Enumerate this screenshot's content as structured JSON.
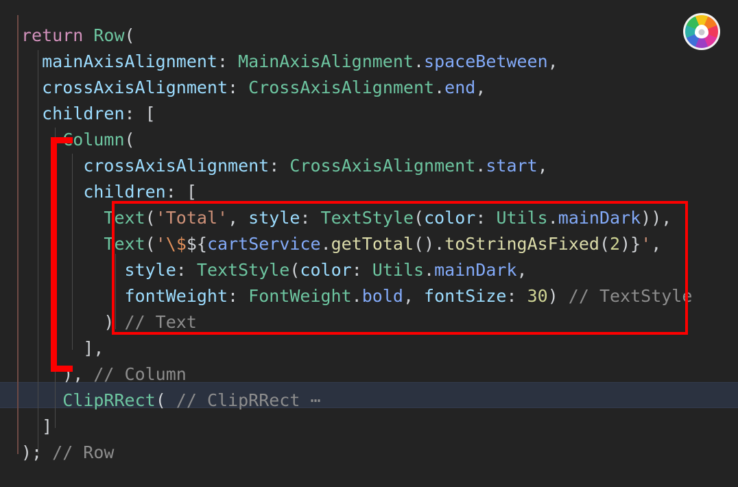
{
  "editor": {
    "background_color": "#232323",
    "current_line_background": "#2b3240",
    "change_bar_color": "#6e4a45",
    "indent_guide_color": "#4a4a4a",
    "font_size_px": 25,
    "line_height_px": 38
  },
  "annotation": {
    "color": "#fd0000",
    "box_label": "text-widgets-highlight",
    "bracket_label": "column-block-bracket"
  },
  "logo": {
    "name": "color-wheel-logo",
    "segment_colors": [
      "#f5c518",
      "#f57c1f",
      "#f0395a",
      "#e0359c",
      "#9b3fc4",
      "#3f6fd8",
      "#2fb0a8",
      "#35bb5a"
    ],
    "hub_color": "#ffffff"
  },
  "code": {
    "language": "dart",
    "lines": [
      {
        "index": 0,
        "indent": "",
        "plain": "return Row(",
        "tokens": [
          {
            "text": "return",
            "kind": "keyword"
          },
          {
            "text": " ",
            "kind": "plain"
          },
          {
            "text": "Row",
            "kind": "class"
          },
          {
            "text": "(",
            "kind": "punct"
          }
        ]
      },
      {
        "index": 1,
        "indent": "  ",
        "plain": "  mainAxisAlignment: MainAxisAlignment.spaceBetween,",
        "tokens": [
          {
            "text": "  ",
            "kind": "pad"
          },
          {
            "text": "mainAxisAlignment",
            "kind": "param"
          },
          {
            "text": ": ",
            "kind": "punct"
          },
          {
            "text": "MainAxisAlignment",
            "kind": "class"
          },
          {
            "text": ".",
            "kind": "punct"
          },
          {
            "text": "spaceBetween",
            "kind": "prop"
          },
          {
            "text": ",",
            "kind": "punct"
          }
        ]
      },
      {
        "index": 2,
        "indent": "  ",
        "plain": "  crossAxisAlignment: CrossAxisAlignment.end,",
        "tokens": [
          {
            "text": "  ",
            "kind": "pad"
          },
          {
            "text": "crossAxisAlignment",
            "kind": "param"
          },
          {
            "text": ": ",
            "kind": "punct"
          },
          {
            "text": "CrossAxisAlignment",
            "kind": "class"
          },
          {
            "text": ".",
            "kind": "punct"
          },
          {
            "text": "end",
            "kind": "prop"
          },
          {
            "text": ",",
            "kind": "punct"
          }
        ]
      },
      {
        "index": 3,
        "indent": "  ",
        "plain": "  children: [",
        "tokens": [
          {
            "text": "  ",
            "kind": "pad"
          },
          {
            "text": "children",
            "kind": "param"
          },
          {
            "text": ": ",
            "kind": "punct"
          },
          {
            "text": "[",
            "kind": "punct"
          }
        ]
      },
      {
        "index": 4,
        "indent": "    ",
        "plain": "    Column(",
        "tokens": [
          {
            "text": "    ",
            "kind": "pad"
          },
          {
            "text": "Column",
            "kind": "class"
          },
          {
            "text": "(",
            "kind": "punct"
          }
        ]
      },
      {
        "index": 5,
        "indent": "      ",
        "plain": "      crossAxisAlignment: CrossAxisAlignment.start,",
        "tokens": [
          {
            "text": "      ",
            "kind": "pad"
          },
          {
            "text": "crossAxisAlignment",
            "kind": "param"
          },
          {
            "text": ": ",
            "kind": "punct"
          },
          {
            "text": "CrossAxisAlignment",
            "kind": "class"
          },
          {
            "text": ".",
            "kind": "punct"
          },
          {
            "text": "start",
            "kind": "prop"
          },
          {
            "text": ",",
            "kind": "punct"
          }
        ]
      },
      {
        "index": 6,
        "indent": "      ",
        "plain": "      children: [",
        "tokens": [
          {
            "text": "      ",
            "kind": "pad"
          },
          {
            "text": "children",
            "kind": "param"
          },
          {
            "text": ": ",
            "kind": "punct"
          },
          {
            "text": "[",
            "kind": "punct"
          }
        ]
      },
      {
        "index": 7,
        "indent": "        ",
        "plain": "        Text('Total', style: TextStyle(color: Utils.mainDark)),",
        "tokens": [
          {
            "text": "        ",
            "kind": "pad"
          },
          {
            "text": "Text",
            "kind": "class"
          },
          {
            "text": "(",
            "kind": "punct"
          },
          {
            "text": "'Total'",
            "kind": "string"
          },
          {
            "text": ", ",
            "kind": "punct"
          },
          {
            "text": "style",
            "kind": "param"
          },
          {
            "text": ": ",
            "kind": "punct"
          },
          {
            "text": "TextStyle",
            "kind": "class"
          },
          {
            "text": "(",
            "kind": "punct"
          },
          {
            "text": "color",
            "kind": "param"
          },
          {
            "text": ": ",
            "kind": "punct"
          },
          {
            "text": "Utils",
            "kind": "class"
          },
          {
            "text": ".",
            "kind": "punct"
          },
          {
            "text": "mainDark",
            "kind": "prop"
          },
          {
            "text": ")),",
            "kind": "punct"
          }
        ]
      },
      {
        "index": 8,
        "indent": "        ",
        "plain": "        Text('\\$${cartService.getTotal().toStringAsFixed(2)}',",
        "tokens": [
          {
            "text": "        ",
            "kind": "pad"
          },
          {
            "text": "Text",
            "kind": "class"
          },
          {
            "text": "(",
            "kind": "punct"
          },
          {
            "text": "'",
            "kind": "string"
          },
          {
            "text": "\\$",
            "kind": "escape"
          },
          {
            "text": "${",
            "kind": "punct"
          },
          {
            "text": "cartService",
            "kind": "prop"
          },
          {
            "text": ".",
            "kind": "punct"
          },
          {
            "text": "getTotal",
            "kind": "method"
          },
          {
            "text": "().",
            "kind": "punct"
          },
          {
            "text": "toStringAsFixed",
            "kind": "method"
          },
          {
            "text": "(",
            "kind": "punct"
          },
          {
            "text": "2",
            "kind": "number"
          },
          {
            "text": ")}",
            "kind": "punct"
          },
          {
            "text": "'",
            "kind": "string"
          },
          {
            "text": ",",
            "kind": "punct"
          }
        ]
      },
      {
        "index": 9,
        "indent": "          ",
        "plain": "          style: TextStyle(color: Utils.mainDark,",
        "tokens": [
          {
            "text": "          ",
            "kind": "pad"
          },
          {
            "text": "style",
            "kind": "param"
          },
          {
            "text": ": ",
            "kind": "punct"
          },
          {
            "text": "TextStyle",
            "kind": "class"
          },
          {
            "text": "(",
            "kind": "punct"
          },
          {
            "text": "color",
            "kind": "param"
          },
          {
            "text": ": ",
            "kind": "punct"
          },
          {
            "text": "Utils",
            "kind": "class"
          },
          {
            "text": ".",
            "kind": "punct"
          },
          {
            "text": "mainDark",
            "kind": "prop"
          },
          {
            "text": ",",
            "kind": "punct"
          }
        ]
      },
      {
        "index": 10,
        "indent": "          ",
        "plain": "          fontWeight: FontWeight.bold, fontSize: 30) // TextStyle",
        "tokens": [
          {
            "text": "          ",
            "kind": "pad"
          },
          {
            "text": "fontWeight",
            "kind": "param"
          },
          {
            "text": ": ",
            "kind": "punct"
          },
          {
            "text": "FontWeight",
            "kind": "class"
          },
          {
            "text": ".",
            "kind": "punct"
          },
          {
            "text": "bold",
            "kind": "prop"
          },
          {
            "text": ", ",
            "kind": "punct"
          },
          {
            "text": "fontSize",
            "kind": "param"
          },
          {
            "text": ": ",
            "kind": "punct"
          },
          {
            "text": "30",
            "kind": "number"
          },
          {
            "text": ") ",
            "kind": "punct"
          },
          {
            "text": "// TextStyle",
            "kind": "comment"
          }
        ]
      },
      {
        "index": 11,
        "indent": "        ",
        "plain": "        ) // Text",
        "tokens": [
          {
            "text": "        ",
            "kind": "pad"
          },
          {
            "text": ") ",
            "kind": "punct"
          },
          {
            "text": "// Text",
            "kind": "comment"
          }
        ]
      },
      {
        "index": 12,
        "indent": "      ",
        "plain": "      ],",
        "tokens": [
          {
            "text": "      ",
            "kind": "pad"
          },
          {
            "text": "],",
            "kind": "punct"
          }
        ]
      },
      {
        "index": 13,
        "indent": "    ",
        "plain": "    ), // Column",
        "tokens": [
          {
            "text": "    ",
            "kind": "pad"
          },
          {
            "text": "), ",
            "kind": "punct"
          },
          {
            "text": "// Column",
            "kind": "comment"
          }
        ]
      },
      {
        "index": 14,
        "indent": "    ",
        "plain": "    ClipRRect( // ClipRRect …",
        "highlighted": true,
        "tokens": [
          {
            "text": "    ",
            "kind": "pad"
          },
          {
            "text": "ClipRRect",
            "kind": "class"
          },
          {
            "text": "( ",
            "kind": "punct"
          },
          {
            "text": "// ClipRRect ⋯",
            "kind": "comment"
          }
        ]
      },
      {
        "index": 15,
        "indent": "  ",
        "plain": "  ]",
        "tokens": [
          {
            "text": "  ",
            "kind": "pad"
          },
          {
            "text": "]",
            "kind": "punct"
          }
        ]
      },
      {
        "index": 16,
        "indent": "",
        "plain": "); // Row",
        "tokens": [
          {
            "text": "); ",
            "kind": "punct"
          },
          {
            "text": "// Row",
            "kind": "comment"
          }
        ]
      }
    ]
  }
}
